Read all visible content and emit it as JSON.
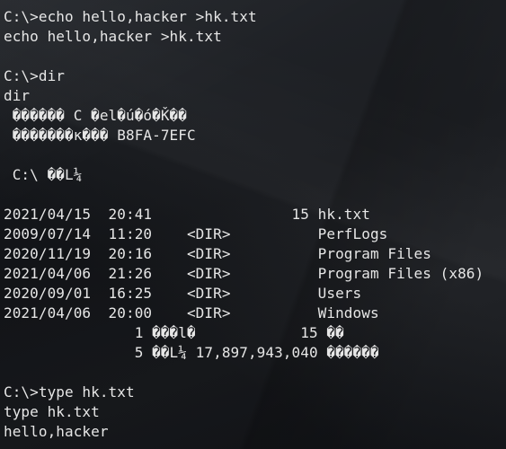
{
  "terminal": {
    "text_color": "#e6e6e6",
    "background_color": "#17191d",
    "lines": [
      "C:\\>echo hello,hacker >hk.txt",
      "echo hello,hacker >hk.txt",
      "",
      "C:\\>dir",
      "dir",
      " ������ C �el�ú�ó�Ǩ��",
      " �������ĸ��� B8FA-7EFC",
      "",
      " C:\\ ��L¼",
      "",
      "2021/04/15  20:41                15 hk.txt",
      "2009/07/14  11:20    <DIR>          PerfLogs",
      "2020/11/19  20:16    <DIR>          Program Files",
      "2021/04/06  21:26    <DIR>          Program Files (x86)",
      "2020/09/01  16:25    <DIR>          Users",
      "2021/04/06  20:00    <DIR>          Windows",
      "               1 ���l�            15 ��",
      "               5 ��L¼ 17,897,943,040 ������",
      "",
      "C:\\>type hk.txt",
      "type hk.txt",
      "hello,hacker"
    ]
  }
}
